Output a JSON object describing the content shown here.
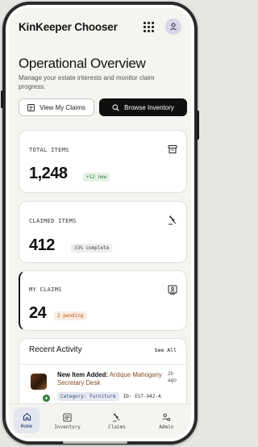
{
  "app": {
    "title": "KinKeeper Chooser"
  },
  "page": {
    "title": "Operational Overview",
    "subtitle": "Manage your estate interests and monitor claim progress."
  },
  "actions": {
    "view_claims": "View My Claims",
    "browse_inventory": "Browse Inventory"
  },
  "stats": {
    "total_items": {
      "label": "TOTAL ITEMS",
      "value": "1,248",
      "badge": "+12 new",
      "badge_color": "#2d7a3d"
    },
    "claimed_items": {
      "label": "CLAIMED ITEMS",
      "value": "412",
      "badge": "33% complete"
    },
    "my_claims": {
      "label": "MY CLAIMS",
      "value": "24",
      "badge": "2 pending",
      "badge_color": "#b35a1f"
    }
  },
  "activity": {
    "title": "Recent Activity",
    "see_all": "See All",
    "items": [
      {
        "prefix": "New Item Added:",
        "item": "Antique Mahogany Secretary Desk",
        "time": "2h ago",
        "category": "Category: Furniture",
        "id": "ID: EST-942-A"
      }
    ]
  },
  "nav": {
    "items": [
      {
        "label": "Home",
        "icon": "home-icon",
        "active": true
      },
      {
        "label": "Inventory",
        "icon": "inventory-icon"
      },
      {
        "label": "Claims",
        "icon": "gavel-icon"
      },
      {
        "label": "Admin",
        "icon": "admin-icon"
      }
    ]
  },
  "colors": {
    "accent": "#1d2e6b",
    "dark_button": "#0f0f0f",
    "brand_brown": "#8a4b1d"
  }
}
